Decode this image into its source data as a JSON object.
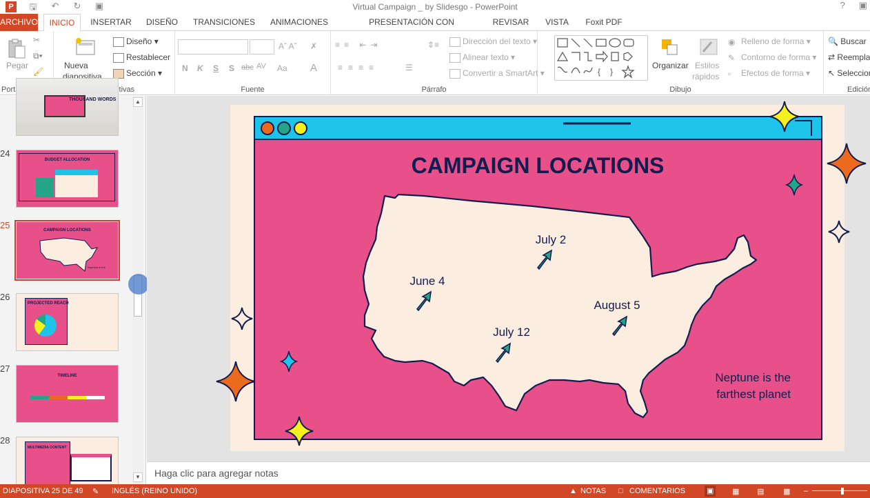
{
  "window": {
    "title": "Virtual Campaign _ by Slidesgo - PowerPoint",
    "help": "?"
  },
  "tabs": [
    {
      "label": "ARCHIVO"
    },
    {
      "label": "INICIO"
    },
    {
      "label": "INSERTAR"
    },
    {
      "label": "DISEÑO"
    },
    {
      "label": "TRANSICIONES"
    },
    {
      "label": "ANIMACIONES"
    },
    {
      "label": "PRESENTACIÓN CON DIAPOSITIVAS"
    },
    {
      "label": "REVISAR"
    },
    {
      "label": "VISTA"
    },
    {
      "label": "Foxit PDF"
    }
  ],
  "ribbon": {
    "clipboard": {
      "paste": "Pegar",
      "label": "Portapapeles"
    },
    "slides": {
      "new_slide_1": "Nueva",
      "new_slide_2": "diapositiva",
      "layout": "Diseño",
      "reset": "Restablecer",
      "section": "Sección",
      "label": "Diapositivas"
    },
    "font": {
      "bold": "N",
      "italic": "K",
      "underline": "S",
      "shadow": "S",
      "strike": "abc",
      "spacing": "AV",
      "case": "Aa",
      "label": "Fuente"
    },
    "paragraph": {
      "text_direction": "Dirección del texto",
      "align_text": "Alinear texto",
      "smartart": "Convertir a SmartArt",
      "label": "Párrafo"
    },
    "drawing": {
      "arrange": "Organizar",
      "quick_styles_1": "Estilos",
      "quick_styles_2": "rápidos",
      "fill": "Relleno de forma",
      "outline": "Contorno de forma",
      "effects": "Efectos de forma",
      "label": "Dibujo"
    },
    "editing": {
      "find": "Buscar",
      "replace": "Reemplazar",
      "select": "Seleccionar",
      "label": "Edición"
    }
  },
  "thumbnails": [
    {
      "num": "",
      "title": "THOUSAND WORDS"
    },
    {
      "num": "24",
      "title": "BUDGET ALLOCATION"
    },
    {
      "num": "25",
      "title": "CAMPAIGN LOCATIONS"
    },
    {
      "num": "26",
      "title": "PROJECTED REACH"
    },
    {
      "num": "27",
      "title": "TIMELINE"
    },
    {
      "num": "28",
      "title": "MULTIMEDIA CONTENT"
    }
  ],
  "slide": {
    "title": "CAMPAIGN LOCATIONS",
    "locations": [
      {
        "label": "July 2"
      },
      {
        "label": "June 4"
      },
      {
        "label": "August 5"
      },
      {
        "label": "July 12"
      }
    ],
    "caption_1": "Neptune is the",
    "caption_2": "farthest planet",
    "colors": {
      "pink": "#e8508a",
      "navy": "#121c4e",
      "cream": "#fbeee0",
      "cyan": "#1ec3ea",
      "orange": "#ec6a1e",
      "yellow": "#f6f01e",
      "green": "#24a58a"
    }
  },
  "notes": {
    "placeholder": "Haga clic para agregar notas"
  },
  "status": {
    "slide_counter": "DIAPOSITIVA 25 DE 49",
    "language": "INGLÉS (REINO UNIDO)",
    "notes": "NOTAS",
    "comments": "COMENTARIOS"
  }
}
